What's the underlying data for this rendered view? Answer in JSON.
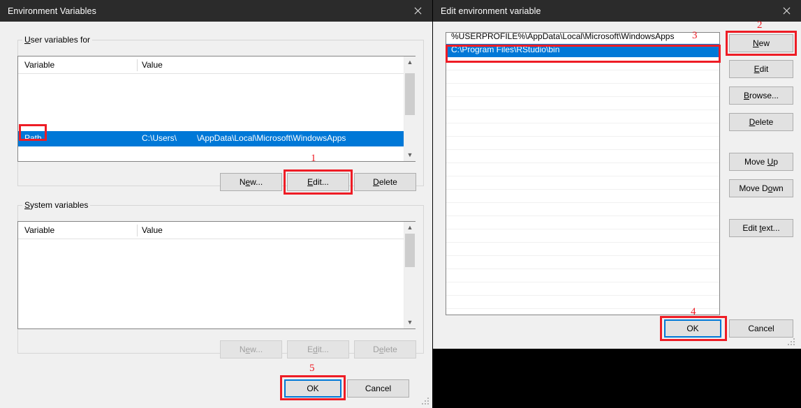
{
  "left_dialog": {
    "title": "Environment Variables",
    "close_icon": "close-icon",
    "user_group": {
      "label_prefix": "U",
      "label_rest": "ser variables for",
      "columns": [
        "Variable",
        "Value"
      ],
      "rows": [
        {
          "variable": "Path",
          "value_prefix": "C:\\Users\\",
          "value_suffix": "\\AppData\\Local\\Microsoft\\WindowsApps",
          "selected": true
        }
      ],
      "buttons": [
        {
          "pre": "N",
          "mn": "e",
          "post": "w...",
          "state": "enabled"
        },
        {
          "pre": "",
          "mn": "E",
          "post": "dit...",
          "state": "enabled"
        },
        {
          "pre": "",
          "mn": "D",
          "post": "elete",
          "state": "enabled"
        }
      ]
    },
    "system_group": {
      "label_prefix": "S",
      "label_rest": "ystem variables",
      "columns": [
        "Variable",
        "Value"
      ],
      "rows": [],
      "buttons": [
        {
          "pre": "N",
          "mn": "e",
          "post": "w...",
          "state": "disabled"
        },
        {
          "pre": "E",
          "mn": "d",
          "post": "it...",
          "state": "disabled"
        },
        {
          "pre": "D",
          "mn": "e",
          "post": "lete",
          "state": "disabled"
        }
      ]
    },
    "ok_label": "OK",
    "cancel_label": "Cancel"
  },
  "right_dialog": {
    "title": "Edit environment variable",
    "close_icon": "close-icon",
    "path_entries": [
      {
        "text": "%USERPROFILE%\\AppData\\Local\\Microsoft\\WindowsApps",
        "selected": false
      },
      {
        "text": "C:\\Program Files\\RStudio\\bin",
        "selected": true
      }
    ],
    "side_buttons": [
      {
        "pre": "",
        "mn": "N",
        "post": "ew"
      },
      {
        "pre": "",
        "mn": "E",
        "post": "dit"
      },
      {
        "pre": "",
        "mn": "B",
        "post": "rowse..."
      },
      {
        "pre": "",
        "mn": "D",
        "post": "elete"
      },
      {
        "pre": "Move ",
        "mn": "U",
        "post": "p"
      },
      {
        "pre": "Move D",
        "mn": "o",
        "post": "wn"
      },
      {
        "pre": "Edit ",
        "mn": "t",
        "post": "ext..."
      }
    ],
    "ok_label": "OK",
    "cancel_label": "Cancel"
  },
  "annotations": [
    {
      "number": "1",
      "target": "edit-button-user"
    },
    {
      "number": "2",
      "target": "new-button-path"
    },
    {
      "number": "3",
      "target": "selected-path-entry"
    },
    {
      "number": "4",
      "target": "ok-button-edit-dialog"
    },
    {
      "number": "5",
      "target": "ok-button-env-dialog"
    }
  ],
  "accent_colors": {
    "selection_blue": "#0078d7",
    "annotation_red": "#ee1c25",
    "titlebar_dark": "#2b2b2b",
    "dialog_face": "#f0f0f0"
  }
}
